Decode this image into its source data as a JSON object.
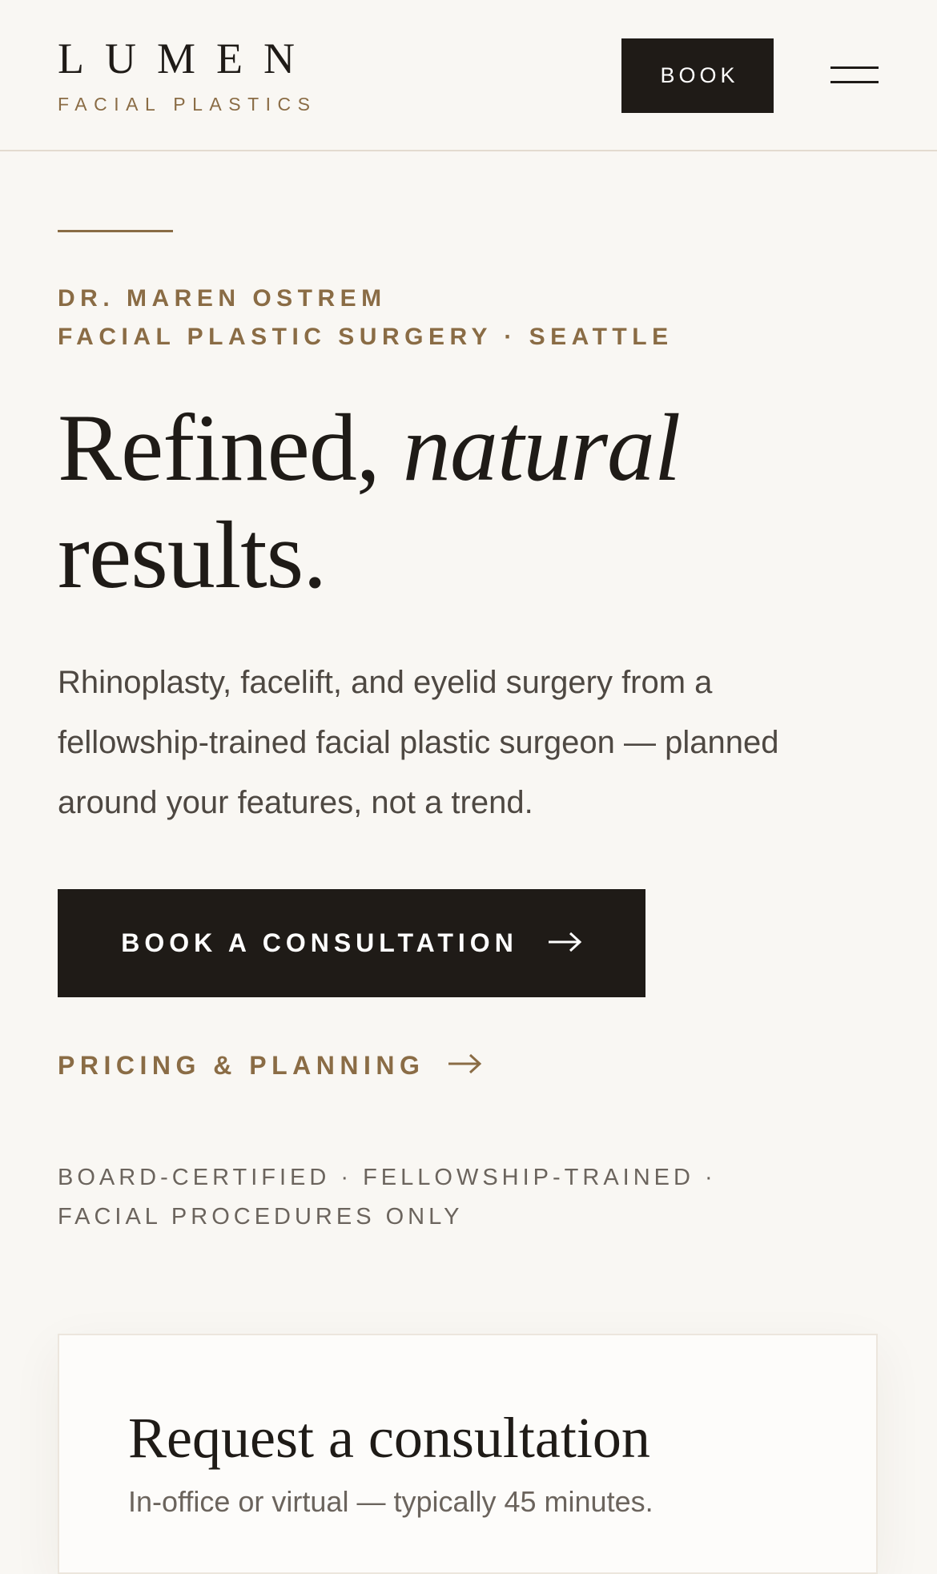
{
  "header": {
    "logo_word": "LUMEN",
    "logo_sub": "FACIAL PLASTICS",
    "book_label": "BOOK",
    "menu_icon": "hamburger-menu-icon"
  },
  "hero": {
    "eyebrow_line1": "DR. MAREN OSTREM",
    "eyebrow_line2": "FACIAL PLASTIC SURGERY · SEATTLE",
    "headline_part1": "Refined, ",
    "headline_italic": "natural",
    "headline_part2": "results.",
    "lede": "Rhinoplasty, facelift, and eyelid surgery from a fellowship-trained facial plastic surgeon — planned around your features, not a trend.",
    "cta_primary_label": "BOOK A CONSULTATION",
    "cta_secondary_label": "PRICING & PLANNING",
    "arrow_icon": "arrow-right-icon",
    "creds_line1": "BOARD-CERTIFIED · FELLOWSHIP-TRAINED ·",
    "creds_line2": "FACIAL PROCEDURES ONLY"
  },
  "consultation_card": {
    "title": "Request a consultation",
    "subtitle": "In-office or virtual — typically 45 minutes."
  },
  "colors": {
    "background": "#f9f7f3",
    "ink": "#1f1b17",
    "accent_gold": "#8a6c45",
    "body_text": "#4e4842",
    "muted_text": "#6b645d"
  }
}
